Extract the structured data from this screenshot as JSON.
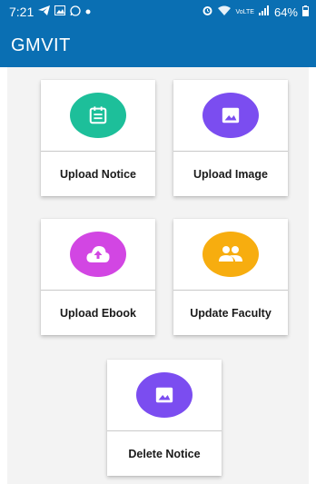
{
  "status_bar": {
    "time": "7:21",
    "network_label": "VoLTE",
    "battery": "64%"
  },
  "app_bar": {
    "title": "GMVIT"
  },
  "cards": [
    {
      "label": "Upload Notice",
      "icon": "notice-icon",
      "color": "#1dbf9a"
    },
    {
      "label": "Upload Image",
      "icon": "image-icon",
      "color": "#7b4df0"
    },
    {
      "label": "Upload Ebook",
      "icon": "cloud-upload-icon",
      "color": "#d246e3"
    },
    {
      "label": "Update Faculty",
      "icon": "people-icon",
      "color": "#f7ad0f"
    },
    {
      "label": "Delete Notice",
      "icon": "image-icon",
      "color": "#7b4df0"
    }
  ],
  "colors": {
    "primary": "#0a6fb3",
    "background": "#f3f3f3"
  }
}
